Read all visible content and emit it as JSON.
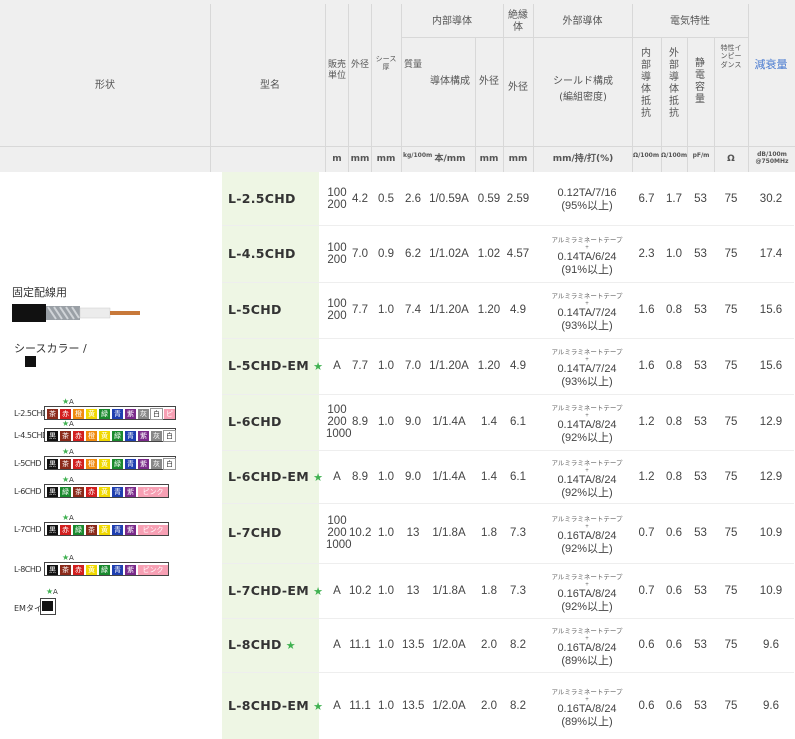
{
  "header": {
    "shape": "形状",
    "model": "型名",
    "unit": "販売単位",
    "od": "外径",
    "sheath": "シース厚",
    "mass": "質量",
    "inner_group": "内部導体",
    "insul_group": "絶縁体",
    "outer_group": "外部導体",
    "elec_group": "電気特性",
    "inner_comp": "導体構成",
    "inner_od": "外径",
    "insul_od": "外径",
    "shield_comp": "シールド構成",
    "shield_density": "(編組密度)",
    "r_inner": "内部導体抵抗",
    "r_outer": "外部導体抵抗",
    "cap": "静電容量",
    "imp": "特性インピーダンス",
    "atten": "減衰量",
    "units": {
      "unit": "m",
      "od": "mm",
      "sheath": "mm",
      "mass": "kg/100m",
      "inner_comp": "本/mm",
      "inner_od": "mm",
      "insul_od": "mm",
      "shield": "mm/持/打(%)",
      "r_inner": "Ω/100m",
      "r_outer": "Ω/100m",
      "cap": "pF/m",
      "imp": "Ω",
      "atten": "dB/100m @750MHz"
    }
  },
  "left": {
    "fixed_label": "固定配線用",
    "sheath_label": "シースカラー /",
    "em_label": "EMタイプ"
  },
  "swatch_rows": [
    {
      "name": "L-2.5CHD",
      "colors": [
        {
          "t": "茶",
          "c": "#8b2a1a"
        },
        {
          "t": "赤",
          "c": "#d21f1f"
        },
        {
          "t": "橙",
          "c": "#f08a0e"
        },
        {
          "t": "黄",
          "c": "#f0d800"
        },
        {
          "t": "緑",
          "c": "#1a8a2e"
        },
        {
          "t": "青",
          "c": "#1f3fb0"
        },
        {
          "t": "紫",
          "c": "#7a2a8a"
        },
        {
          "t": "灰",
          "c": "#888888"
        },
        {
          "t": "白",
          "c": "#ffffff"
        },
        {
          "t": "ピ",
          "c": "#f7a0b4"
        }
      ]
    },
    {
      "name": "L-4.5CHD",
      "colors": [
        {
          "t": "黒",
          "c": "#111111"
        },
        {
          "t": "茶",
          "c": "#8b2a1a"
        },
        {
          "t": "赤",
          "c": "#d21f1f"
        },
        {
          "t": "橙",
          "c": "#f08a0e"
        },
        {
          "t": "黄",
          "c": "#f0d800"
        },
        {
          "t": "緑",
          "c": "#1a8a2e"
        },
        {
          "t": "青",
          "c": "#1f3fb0"
        },
        {
          "t": "紫",
          "c": "#7a2a8a"
        },
        {
          "t": "灰",
          "c": "#888888"
        },
        {
          "t": "白",
          "c": "#ffffff"
        }
      ]
    },
    {
      "name": "L-5CHD",
      "colors": [
        {
          "t": "黒",
          "c": "#111111"
        },
        {
          "t": "茶",
          "c": "#8b2a1a"
        },
        {
          "t": "赤",
          "c": "#d21f1f"
        },
        {
          "t": "橙",
          "c": "#f08a0e"
        },
        {
          "t": "黄",
          "c": "#f0d800"
        },
        {
          "t": "緑",
          "c": "#1a8a2e"
        },
        {
          "t": "青",
          "c": "#1f3fb0"
        },
        {
          "t": "紫",
          "c": "#7a2a8a"
        },
        {
          "t": "灰",
          "c": "#888888"
        },
        {
          "t": "白",
          "c": "#ffffff"
        }
      ]
    },
    {
      "name": "L-6CHD",
      "colors": [
        {
          "t": "黒",
          "c": "#111111"
        },
        {
          "t": "緑",
          "c": "#1a8a2e"
        },
        {
          "t": "茶",
          "c": "#8b2a1a"
        },
        {
          "t": "赤",
          "c": "#d21f1f"
        },
        {
          "t": "黄",
          "c": "#f0d800"
        },
        {
          "t": "青",
          "c": "#1f3fb0"
        },
        {
          "t": "紫",
          "c": "#7a2a8a"
        },
        {
          "t": "ピンク",
          "c": "#f7a0b4"
        }
      ]
    },
    {
      "name": "L-7CHD",
      "colors": [
        {
          "t": "黒",
          "c": "#111111"
        },
        {
          "t": "赤",
          "c": "#d21f1f"
        },
        {
          "t": "緑",
          "c": "#1a8a2e"
        },
        {
          "t": "茶",
          "c": "#8b2a1a"
        },
        {
          "t": "黄",
          "c": "#f0d800"
        },
        {
          "t": "青",
          "c": "#1f3fb0"
        },
        {
          "t": "紫",
          "c": "#7a2a8a"
        },
        {
          "t": "ピンク",
          "c": "#f7a0b4"
        }
      ]
    },
    {
      "name": "L-8CHD",
      "colors": [
        {
          "t": "黒",
          "c": "#111111"
        },
        {
          "t": "茶",
          "c": "#8b2a1a"
        },
        {
          "t": "赤",
          "c": "#d21f1f"
        },
        {
          "t": "黄",
          "c": "#f0d800"
        },
        {
          "t": "緑",
          "c": "#1a8a2e"
        },
        {
          "t": "青",
          "c": "#1f3fb0"
        },
        {
          "t": "紫",
          "c": "#7a2a8a"
        },
        {
          "t": "ピンク",
          "c": "#f7a0b4"
        }
      ]
    }
  ],
  "em_swatch": {
    "t": "黒",
    "c": "#111111"
  },
  "star_a": "A",
  "rows": [
    {
      "model": "L-2.5CHD",
      "star": "",
      "unit": "100\n200",
      "od": "4.2",
      "sheath": "0.5",
      "mass": "2.6",
      "inner": "1/0.59A",
      "inner_od": "0.59",
      "insul_od": "2.59",
      "tape": "",
      "shield": "0.12TA/7/16",
      "density": "(95%以上)",
      "ri": "6.7",
      "ro": "1.7",
      "cap": "53",
      "imp": "75",
      "att": "30.2"
    },
    {
      "model": "L-4.5CHD",
      "star": "",
      "unit": "100\n200",
      "od": "7.0",
      "sheath": "0.9",
      "mass": "6.2",
      "inner": "1/1.02A",
      "inner_od": "1.02",
      "insul_od": "4.57",
      "tape": "アルミラミネートテープ",
      "shield": "0.14TA/6/24",
      "density": "(91%以上)",
      "ri": "2.3",
      "ro": "1.0",
      "cap": "53",
      "imp": "75",
      "att": "17.4"
    },
    {
      "model": "L-5CHD",
      "star": "",
      "unit": "100\n200",
      "od": "7.7",
      "sheath": "1.0",
      "mass": "7.4",
      "inner": "1/1.20A",
      "inner_od": "1.20",
      "insul_od": "4.9",
      "tape": "アルミラミネートテープ",
      "shield": "0.14TA/7/24",
      "density": "(93%以上)",
      "ri": "1.6",
      "ro": "0.8",
      "cap": "53",
      "imp": "75",
      "att": "15.6"
    },
    {
      "model": "L-5CHD-EM",
      "star": "★",
      "unit": "A",
      "od": "7.7",
      "sheath": "1.0",
      "mass": "7.0",
      "inner": "1/1.20A",
      "inner_od": "1.20",
      "insul_od": "4.9",
      "tape": "アルミラミネートテープ",
      "shield": "0.14TA/7/24",
      "density": "(93%以上)",
      "ri": "1.6",
      "ro": "0.8",
      "cap": "53",
      "imp": "75",
      "att": "15.6"
    },
    {
      "model": "L-6CHD",
      "star": "",
      "unit": "100\n200\n1000",
      "od": "8.9",
      "sheath": "1.0",
      "mass": "9.0",
      "inner": "1/1.4A",
      "inner_od": "1.4",
      "insul_od": "6.1",
      "tape": "アルミラミネートテープ",
      "shield": "0.14TA/8/24",
      "density": "(92%以上)",
      "ri": "1.2",
      "ro": "0.8",
      "cap": "53",
      "imp": "75",
      "att": "12.9"
    },
    {
      "model": "L-6CHD-EM",
      "star": "★",
      "unit": "A",
      "od": "8.9",
      "sheath": "1.0",
      "mass": "9.0",
      "inner": "1/1.4A",
      "inner_od": "1.4",
      "insul_od": "6.1",
      "tape": "アルミラミネートテープ",
      "shield": "0.14TA/8/24",
      "density": "(92%以上)",
      "ri": "1.2",
      "ro": "0.8",
      "cap": "53",
      "imp": "75",
      "att": "12.9"
    },
    {
      "model": "L-7CHD",
      "star": "",
      "unit": "100\n200\n1000",
      "od": "10.2",
      "sheath": "1.0",
      "mass": "13",
      "inner": "1/1.8A",
      "inner_od": "1.8",
      "insul_od": "7.3",
      "tape": "アルミラミネートテープ",
      "shield": "0.16TA/8/24",
      "density": "(92%以上)",
      "ri": "0.7",
      "ro": "0.6",
      "cap": "53",
      "imp": "75",
      "att": "10.9"
    },
    {
      "model": "L-7CHD-EM",
      "star": "★",
      "unit": "A",
      "od": "10.2",
      "sheath": "1.0",
      "mass": "13",
      "inner": "1/1.8A",
      "inner_od": "1.8",
      "insul_od": "7.3",
      "tape": "アルミラミネートテープ",
      "shield": "0.16TA/8/24",
      "density": "(92%以上)",
      "ri": "0.7",
      "ro": "0.6",
      "cap": "53",
      "imp": "75",
      "att": "10.9"
    },
    {
      "model": "L-8CHD",
      "star": "★",
      "unit": "A",
      "od": "11.1",
      "sheath": "1.0",
      "mass": "13.5",
      "inner": "1/2.0A",
      "inner_od": "2.0",
      "insul_od": "8.2",
      "tape": "アルミラミネートテープ",
      "shield": "0.16TA/8/24",
      "density": "(89%以上)",
      "ri": "0.6",
      "ro": "0.6",
      "cap": "53",
      "imp": "75",
      "att": "9.6"
    },
    {
      "model": "L-8CHD-EM",
      "star": "★",
      "unit": "A",
      "od": "11.1",
      "sheath": "1.0",
      "mass": "13.5",
      "inner": "1/2.0A",
      "inner_od": "2.0",
      "insul_od": "8.2",
      "tape": "アルミラミネートテープ",
      "shield": "0.16TA/8/24",
      "density": "(89%以上)",
      "ri": "0.6",
      "ro": "0.6",
      "cap": "53",
      "imp": "75",
      "att": "9.6"
    }
  ]
}
